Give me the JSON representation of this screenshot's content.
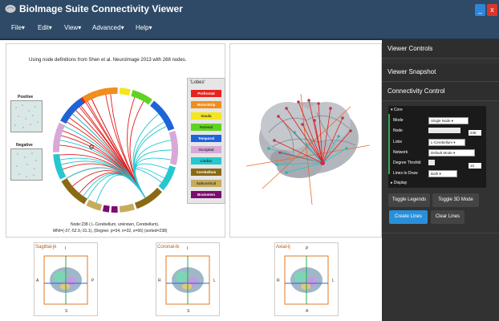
{
  "app": {
    "title": "BioImage Suite Connectivity Viewer",
    "min_label": "_",
    "close_label": "x"
  },
  "menu": [
    {
      "label": "File"
    },
    {
      "label": "Edit"
    },
    {
      "label": "View"
    },
    {
      "label": "Advanced"
    },
    {
      "label": "Help"
    }
  ],
  "chord": {
    "caption": "Using node definitions from Shen et al. NeuroImage 2013 with 268 nodes.",
    "positive_label": "Positive",
    "negative_label": "Negative",
    "node_info": "Node:238 ( L-Cerebellum, unknown, Cerebellum).",
    "mni_info": "MNI=(-37,-52.9,-31.1), (Degree: p=34, n=32, s=66) (sorted=238)",
    "lobes_title": "'Lobes'",
    "lobes": [
      {
        "name": "Prefrontal",
        "color": "#e8231f"
      },
      {
        "name": "MotorStrip",
        "color": "#f28c1c"
      },
      {
        "name": "Insula",
        "color": "#f2e61c"
      },
      {
        "name": "Parietal",
        "color": "#5fd321"
      },
      {
        "name": "Temporal",
        "color": "#1e63d8"
      },
      {
        "name": "Occipital",
        "color": "#d9a8d8"
      },
      {
        "name": "Limbic",
        "color": "#26c7cf"
      },
      {
        "name": "Cerebellum",
        "color": "#8b6a14"
      },
      {
        "name": "Subcortical",
        "color": "#c7ab5b"
      },
      {
        "name": "Brainstem",
        "color": "#7c0c6e"
      }
    ]
  },
  "views": [
    {
      "title": "Sagittal-jk",
      "top": "I",
      "bottom": "S",
      "left": "A",
      "right": "P"
    },
    {
      "title": "Coronal-ik",
      "top": "I",
      "bottom": "S",
      "left": "R",
      "right": "L"
    },
    {
      "title": "Axial-ij",
      "top": "P",
      "bottom": "A",
      "left": "R",
      "right": "L"
    }
  ],
  "sidebar": {
    "viewer_controls": "Viewer Controls",
    "viewer_snapshot": "Viewer Snapshot",
    "connectivity_control": "Connectivity Control",
    "core_section": "Core",
    "display_section": "Display",
    "fields": {
      "mode_label": "Mode",
      "mode_value": "Single Node",
      "node_label": "Node",
      "node_value": "238",
      "lobe_label": "Lobe",
      "lobe_value": "L-Cerebellum",
      "network_label": "Network",
      "network_value": "Default Mode",
      "threshold_label": "Degree Thrshld",
      "threshold_value": "10",
      "lines_label": "Lines to Draw",
      "lines_value": "Both"
    },
    "buttons": {
      "toggle_legends": "Toggle Legends",
      "toggle_3d": "Toggle 3D Mode",
      "create_lines": "Create Lines",
      "clear_lines": "Clear Lines"
    }
  }
}
